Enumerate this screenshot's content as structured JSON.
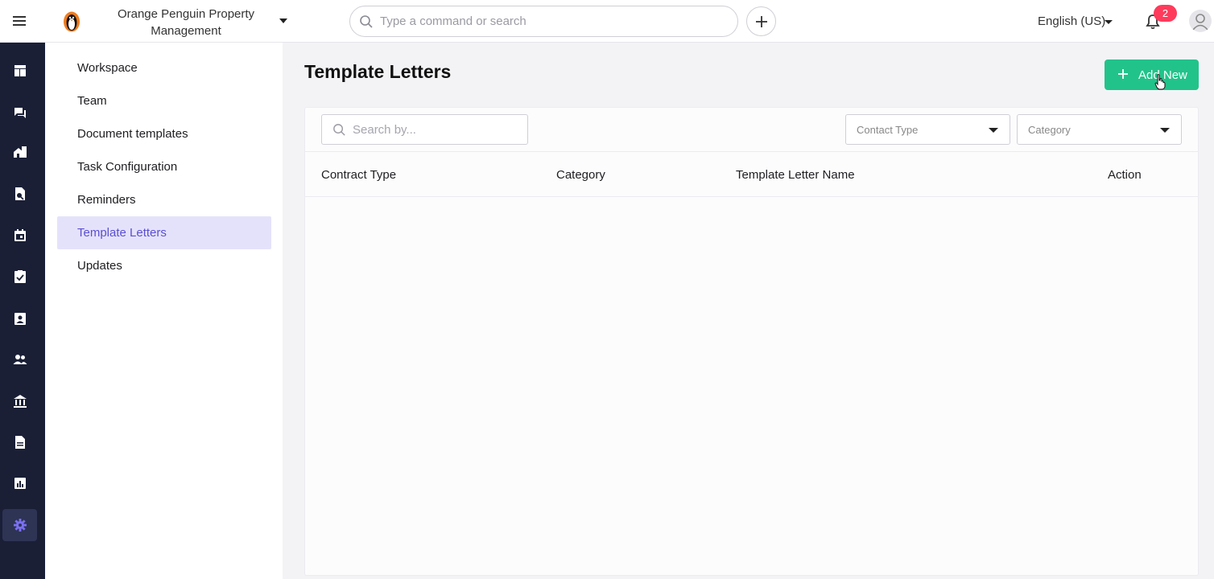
{
  "topbar": {
    "org_name": "Orange Penguin Property Management",
    "search_placeholder": "Type a command or search",
    "language": "English (US)",
    "notification_count": "2"
  },
  "rail": {
    "items": [
      {
        "icon": "dashboard-icon",
        "active": false
      },
      {
        "icon": "chat-icon",
        "active": false
      },
      {
        "icon": "properties-icon",
        "active": false
      },
      {
        "icon": "leasing-icon",
        "active": false
      },
      {
        "icon": "calendar-icon",
        "active": false
      },
      {
        "icon": "tasks-icon",
        "active": false
      },
      {
        "icon": "contacts-icon",
        "active": false
      },
      {
        "icon": "people-icon",
        "active": false
      },
      {
        "icon": "bank-icon",
        "active": false
      },
      {
        "icon": "document-icon",
        "active": false
      },
      {
        "icon": "reports-icon",
        "active": false
      },
      {
        "icon": "gear-icon",
        "active": true
      }
    ],
    "colors": {
      "icon": "#ffffff",
      "active_icon": "#7b6ff0"
    }
  },
  "sidebar": {
    "items": [
      {
        "label": "Workspace"
      },
      {
        "label": "Team"
      },
      {
        "label": "Document templates"
      },
      {
        "label": "Task Configuration"
      },
      {
        "label": "Reminders"
      },
      {
        "label": "Template Letters",
        "active": true
      },
      {
        "label": "Updates"
      }
    ]
  },
  "main": {
    "title": "Template Letters",
    "add_label": "Add New",
    "search_placeholder": "Search by...",
    "filters": {
      "contact_type": "Contact Type",
      "category": "Category"
    },
    "columns": [
      "Contract Type",
      "Category",
      "Template Letter Name",
      "Action"
    ]
  },
  "colors": {
    "accent": "#22c38a",
    "active_bg": "#e4e2fb",
    "active_text": "#5b4fd1",
    "rail_bg": "#1a1f36",
    "badge": "#ff3b5c"
  }
}
